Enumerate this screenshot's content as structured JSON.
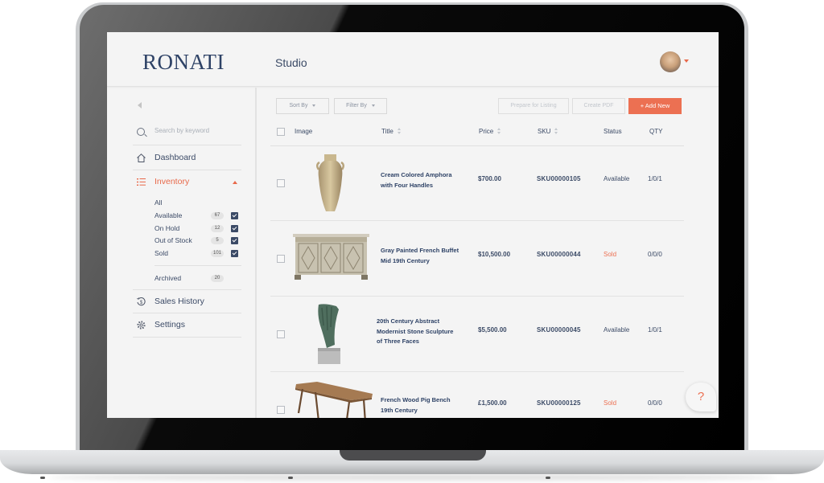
{
  "app": {
    "logo": "RONATI",
    "page_title": "Studio",
    "user_menu": {
      "avatar_alt": "user-avatar",
      "caret": "chevron-down-icon"
    }
  },
  "colors": {
    "accent": "#ec7052",
    "text_primary": "#3b4a66",
    "brand_navy": "#2e4266",
    "background": "#f4f4f4"
  },
  "sidebar": {
    "collapse_icon": "chevron-left-icon",
    "search": {
      "placeholder": "Search by keyword",
      "value": ""
    },
    "items": [
      {
        "label": "Dashboard",
        "icon": "home-icon",
        "active": false
      },
      {
        "label": "Inventory",
        "icon": "list-icon",
        "active": true,
        "expanded": true
      },
      {
        "label": "Sales History",
        "icon": "sales-history-icon",
        "active": false
      },
      {
        "label": "Settings",
        "icon": "gear-icon",
        "active": false
      }
    ],
    "inventory_filters": [
      {
        "label": "All"
      },
      {
        "label": "Available",
        "count": "67",
        "checked": true
      },
      {
        "label": "On Hold",
        "count": "12",
        "checked": true
      },
      {
        "label": "Out of Stock",
        "count": "5",
        "checked": true
      },
      {
        "label": "Sold",
        "count": "101",
        "checked": true
      }
    ],
    "archived": {
      "label": "Archived",
      "count": "20"
    }
  },
  "toolbar": {
    "sort_by": "Sort By",
    "filter_by": "Filter By",
    "prepare_listing": "Prepare for Listing",
    "create_pdf": "Create PDF",
    "add_new": "+ Add New"
  },
  "table": {
    "columns": [
      "Image",
      "Title",
      "Price",
      "SKU",
      "Status",
      "QTY"
    ],
    "rows": [
      {
        "image": "amphora",
        "title_line1": "Cream Colored Amphora",
        "title_line2": "with Four Handles",
        "title_line3": "",
        "price": "$700.00",
        "sku": "SKU00000105",
        "status": "Available",
        "qty": "1/0/1"
      },
      {
        "image": "buffet",
        "title_line1": "Gray Painted French Buffet",
        "title_line2": "Mid 19th Century",
        "title_line3": "",
        "price": "$10,500.00",
        "sku": "SKU00000044",
        "status": "Sold",
        "qty": "0/0/0"
      },
      {
        "image": "sculpture",
        "title_line1": "20th Century Abstract",
        "title_line2": "Modernist Stone Sculpture",
        "title_line3": "of Three Faces",
        "price": "$5,500.00",
        "sku": "SKU00000045",
        "status": "Available",
        "qty": "1/0/1"
      },
      {
        "image": "bench",
        "title_line1": "French Wood Pig Bench",
        "title_line2": "19th Century",
        "title_line3": "",
        "price": "£1,500.00",
        "sku": "SKU00000125",
        "status": "Sold",
        "qty": "0/0/0"
      }
    ]
  },
  "help": {
    "label": "?"
  }
}
